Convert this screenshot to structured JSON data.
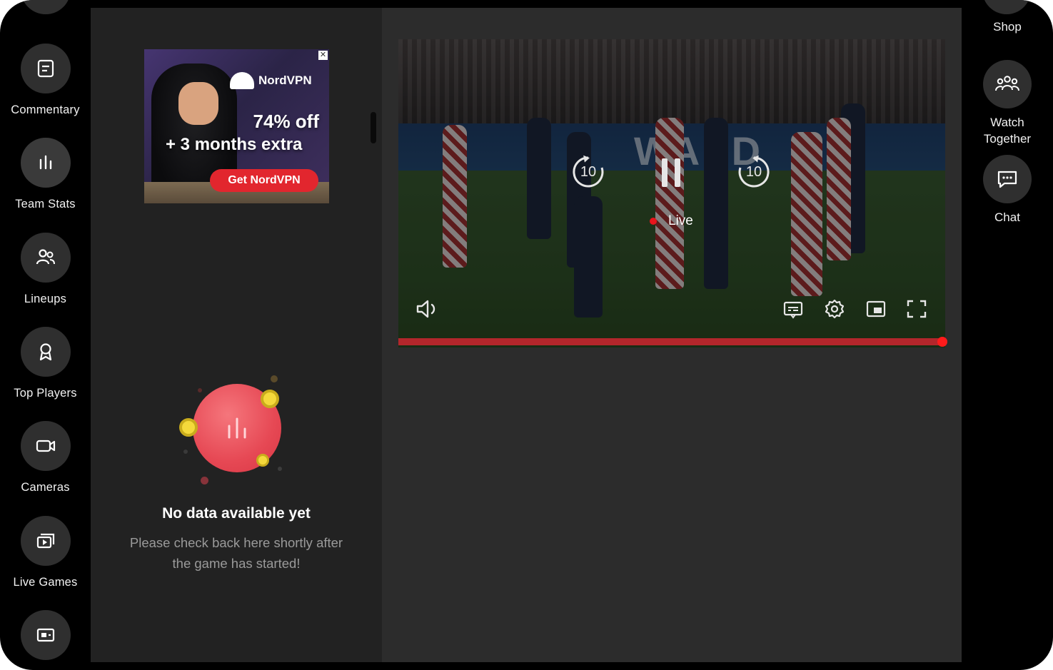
{
  "left_rail": {
    "items": [
      {
        "label": "Commentary",
        "icon": "commentary-icon"
      },
      {
        "label": "Team Stats",
        "icon": "bar-chart-icon"
      },
      {
        "label": "Lineups",
        "icon": "people-icon"
      },
      {
        "label": "Top Players",
        "icon": "award-icon"
      },
      {
        "label": "Cameras",
        "icon": "camera-icon"
      },
      {
        "label": "Live Games",
        "icon": "live-games-icon"
      }
    ]
  },
  "ad": {
    "brand": "NordVPN",
    "offer": "74% off",
    "extra": "+ 3 months extra",
    "cta": "Get NordVPN",
    "close": "✕"
  },
  "empty_state": {
    "title": "No data available yet",
    "line1": "Please check back here shortly after",
    "line2": "the game has started!"
  },
  "player": {
    "rewind_label": "10",
    "forward_label": "10",
    "status": "Live",
    "progress": 1.0,
    "board_text": "WAND",
    "accent_color": "#e8141c"
  },
  "right_rail": {
    "items": [
      {
        "label": "Shop",
        "icon": "shop-icon"
      },
      {
        "label_line1": "Watch",
        "label_line2": "Together",
        "icon": "group-icon"
      },
      {
        "label": "Chat",
        "icon": "chat-icon"
      }
    ]
  }
}
